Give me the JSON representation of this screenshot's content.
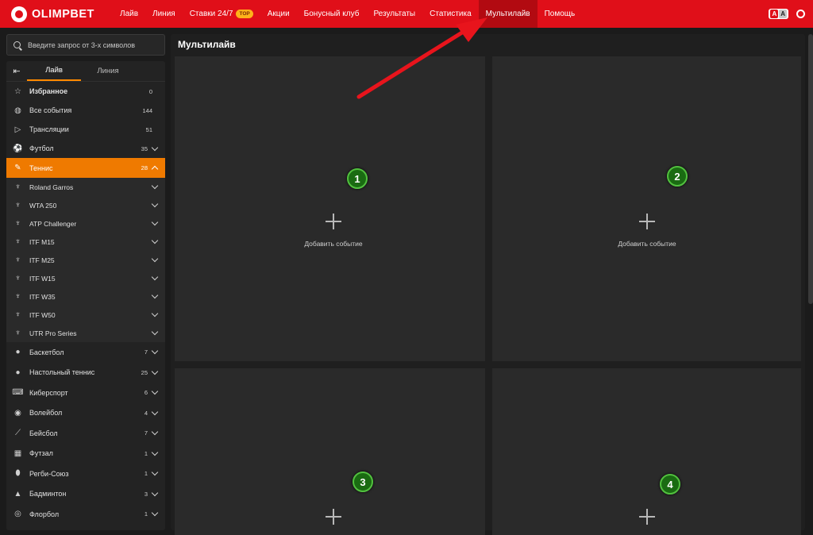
{
  "topbar": {
    "brand": "OLIMPBET",
    "nav": [
      {
        "label": "Лайв"
      },
      {
        "label": "Линия"
      },
      {
        "label": "Ставки 24/7",
        "badge": "TOP"
      },
      {
        "label": "Акции"
      },
      {
        "label": "Бонусный клуб"
      },
      {
        "label": "Результаты"
      },
      {
        "label": "Статистика"
      },
      {
        "label": "Мультилайв",
        "active": true
      },
      {
        "label": "Помощь"
      }
    ],
    "font_small": "A",
    "font_big": "A"
  },
  "search": {
    "placeholder": "Введите запрос от 3-х символов"
  },
  "sidebar": {
    "collapse_glyph": "⇤",
    "tabs": {
      "live": "Лайв",
      "line": "Линия"
    },
    "items": [
      {
        "label": "Избранное",
        "count": "0",
        "icon": "star-icon",
        "glyph": "☆"
      },
      {
        "label": "Все события",
        "count": "144",
        "icon": "globe-icon",
        "glyph": "◍"
      },
      {
        "label": "Трансляции",
        "count": "51",
        "icon": "play-icon",
        "glyph": "▷"
      },
      {
        "label": "Футбол",
        "count": "35",
        "icon": "soccer-ball-icon",
        "glyph": "⚽"
      },
      {
        "label": "Теннис",
        "count": "28",
        "icon": "tennis-racket-icon",
        "glyph": "✎"
      }
    ],
    "tennis_subs": [
      "Roland Garros",
      "WTA 250",
      "ATP Challenger",
      "ITF M15",
      "ITF M25",
      "ITF W15",
      "ITF W35",
      "ITF W50",
      "UTR Pro Series"
    ],
    "sports": [
      {
        "label": "Баскетбол",
        "count": "7",
        "icon": "basketball-icon",
        "glyph": "●"
      },
      {
        "label": "Настольный теннис",
        "count": "25",
        "icon": "table-tennis-icon",
        "glyph": "●"
      },
      {
        "label": "Киберспорт",
        "count": "6",
        "icon": "gamepad-icon",
        "glyph": "⌨"
      },
      {
        "label": "Волейбол",
        "count": "4",
        "icon": "volleyball-icon",
        "glyph": "◉"
      },
      {
        "label": "Бейсбол",
        "count": "7",
        "icon": "baseball-bat-icon",
        "glyph": "⟋"
      },
      {
        "label": "Футзал",
        "count": "1",
        "icon": "futsal-goal-icon",
        "glyph": "▦"
      },
      {
        "label": "Регби-Союз",
        "count": "1",
        "icon": "rugby-ball-icon",
        "glyph": "⬮"
      },
      {
        "label": "Бадминтон",
        "count": "3",
        "icon": "shuttlecock-icon",
        "glyph": "▲"
      },
      {
        "label": "Флорбол",
        "count": "1",
        "icon": "floorball-icon",
        "glyph": "◎"
      }
    ]
  },
  "main": {
    "title": "Мультилайв",
    "slots": [
      {
        "add_label": "Добавить событие",
        "badge": "1"
      },
      {
        "add_label": "Добавить событие",
        "badge": "2"
      },
      {
        "add_label": "",
        "badge": "3"
      },
      {
        "add_label": "",
        "badge": "4"
      }
    ]
  },
  "colors": {
    "brand_red": "#e00f19",
    "accent_orange": "#ef7a00",
    "badge_green": "#1a6b12",
    "arrow_red": "#e8141c"
  }
}
